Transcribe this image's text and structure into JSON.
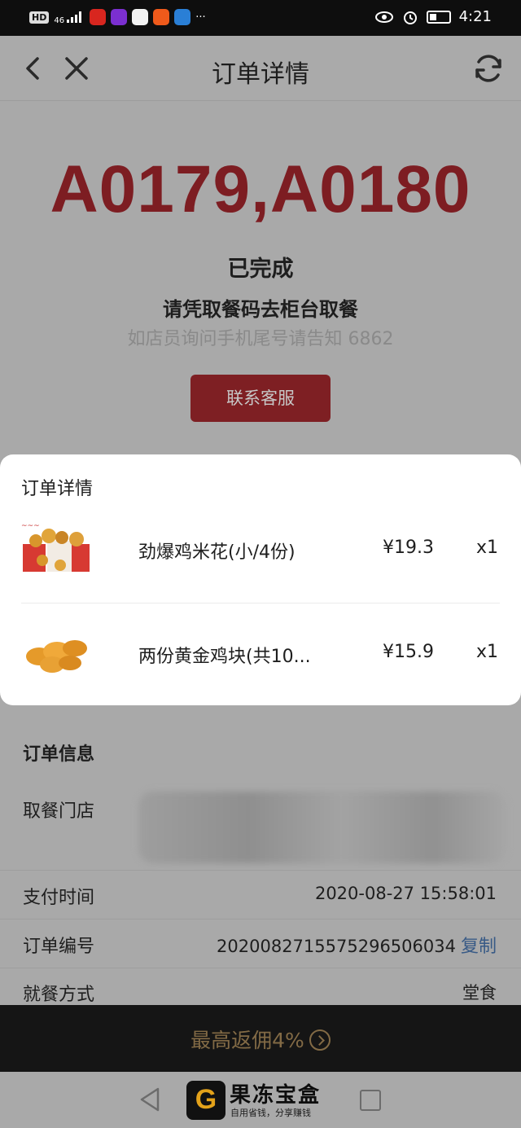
{
  "status_bar": {
    "hd": "HD",
    "signal": "46",
    "more": "···",
    "time": "4:21"
  },
  "header": {
    "title": "订单详情"
  },
  "order": {
    "pickup_codes": "A0179,A0180",
    "status": "已完成",
    "hint": "请凭取餐码去柜台取餐",
    "phone_hint": "如店员询问手机尾号请告知 6862",
    "contact_button": "联系客服"
  },
  "items_card": {
    "title": "订单详情",
    "items": [
      {
        "name": "劲爆鸡米花(小/4份)",
        "price": "¥19.3",
        "qty": "x1"
      },
      {
        "name": "两份黄金鸡块(共10...",
        "price": "¥15.9",
        "qty": "x1"
      }
    ]
  },
  "order_info": {
    "title": "订单信息",
    "store_label": "取餐门店",
    "pay_time_label": "支付时间",
    "pay_time": "2020-08-27 15:58:01",
    "order_no_label": "订单编号",
    "order_no": "2020082715575296506034",
    "copy_label": "复制",
    "dine_label": "就餐方式",
    "dine_value": "堂食"
  },
  "promo": {
    "text": "最高返佣4%"
  },
  "watermark": {
    "logo_letter": "G",
    "name": "果冻宝盒",
    "slogan": "自用省钱，分享赚钱"
  },
  "colors": {
    "accent_red": "#7e1f23",
    "link_blue": "#385a86",
    "promo_gold": "#826a45"
  }
}
